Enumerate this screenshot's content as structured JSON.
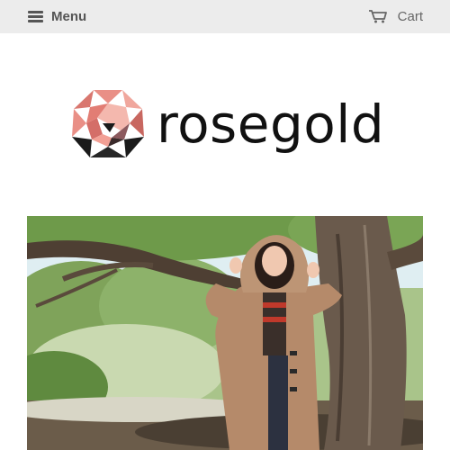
{
  "header": {
    "menu_label": "Menu",
    "menu_icon": "hamburger-icon",
    "cart_label": "Cart",
    "cart_icon": "cart-icon",
    "background": "#ececec"
  },
  "brand": {
    "name": "rosegold",
    "logo_icon": "rose-geometric-logo",
    "colors": {
      "pink": "#e98f86",
      "dark": "#1a1a1a",
      "mauve": "#8c5a5e"
    }
  },
  "hero": {
    "image_icon": "hero-photo",
    "description_colors": {
      "sky": "#dfeef2",
      "foliage": "#5f8a3f",
      "coat": "#b58a6a"
    }
  }
}
